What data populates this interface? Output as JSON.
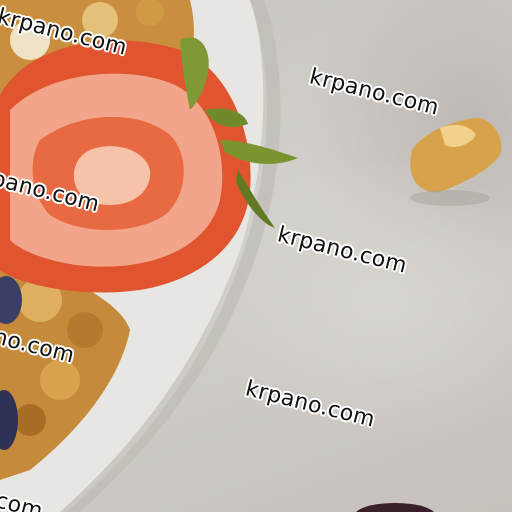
{
  "watermarks": [
    "krpano.com",
    "krpano.com",
    "pano.com",
    "krpano.com",
    "no.com",
    "krpano.com",
    "com"
  ],
  "colors": {
    "background": "#cfcac6",
    "bowl": "#e8e6e3",
    "strawberry": "#e0552f",
    "strawberry_flesh": "#f2a58a",
    "leaf": "#6e8a2a",
    "granola": "#d7a24b",
    "blueberry": "#3a3f66"
  }
}
